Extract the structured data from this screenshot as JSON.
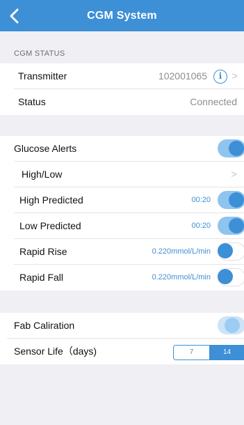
{
  "header": {
    "title": "CGM System",
    "back_icon": "chevron-left-icon"
  },
  "cgm_status": {
    "section_title": "CGM STATUS",
    "transmitter": {
      "label": "Transmitter",
      "value": "102001065",
      "icon": "info-icon",
      "chevron": ">"
    },
    "status": {
      "label": "Status",
      "value": "Connected"
    }
  },
  "alerts": {
    "glucose_alerts": {
      "label": "Glucose Alerts",
      "enabled": true
    },
    "high_low": {
      "label": "High/Low",
      "chevron": ">"
    },
    "high_predicted": {
      "label": "High Predicted",
      "value": "00:20",
      "enabled": true
    },
    "low_predicted": {
      "label": "Low Predicted",
      "value": "00:20",
      "enabled": true
    },
    "rapid_rise": {
      "label": "Rapid Rise",
      "value": "0.220mmol/L/min",
      "enabled": false
    },
    "rapid_fall": {
      "label": "Rapid Fall",
      "value": "0.220mmol/L/min",
      "enabled": false
    }
  },
  "calibration": {
    "fab_calibration": {
      "label": "Fab Caliration",
      "enabled": false
    },
    "sensor_life": {
      "label": "Sensor Life（days)",
      "options": [
        "7",
        "14"
      ],
      "selected": "14"
    }
  },
  "colors": {
    "accent": "#3d8fd6",
    "background": "#efeff4"
  }
}
